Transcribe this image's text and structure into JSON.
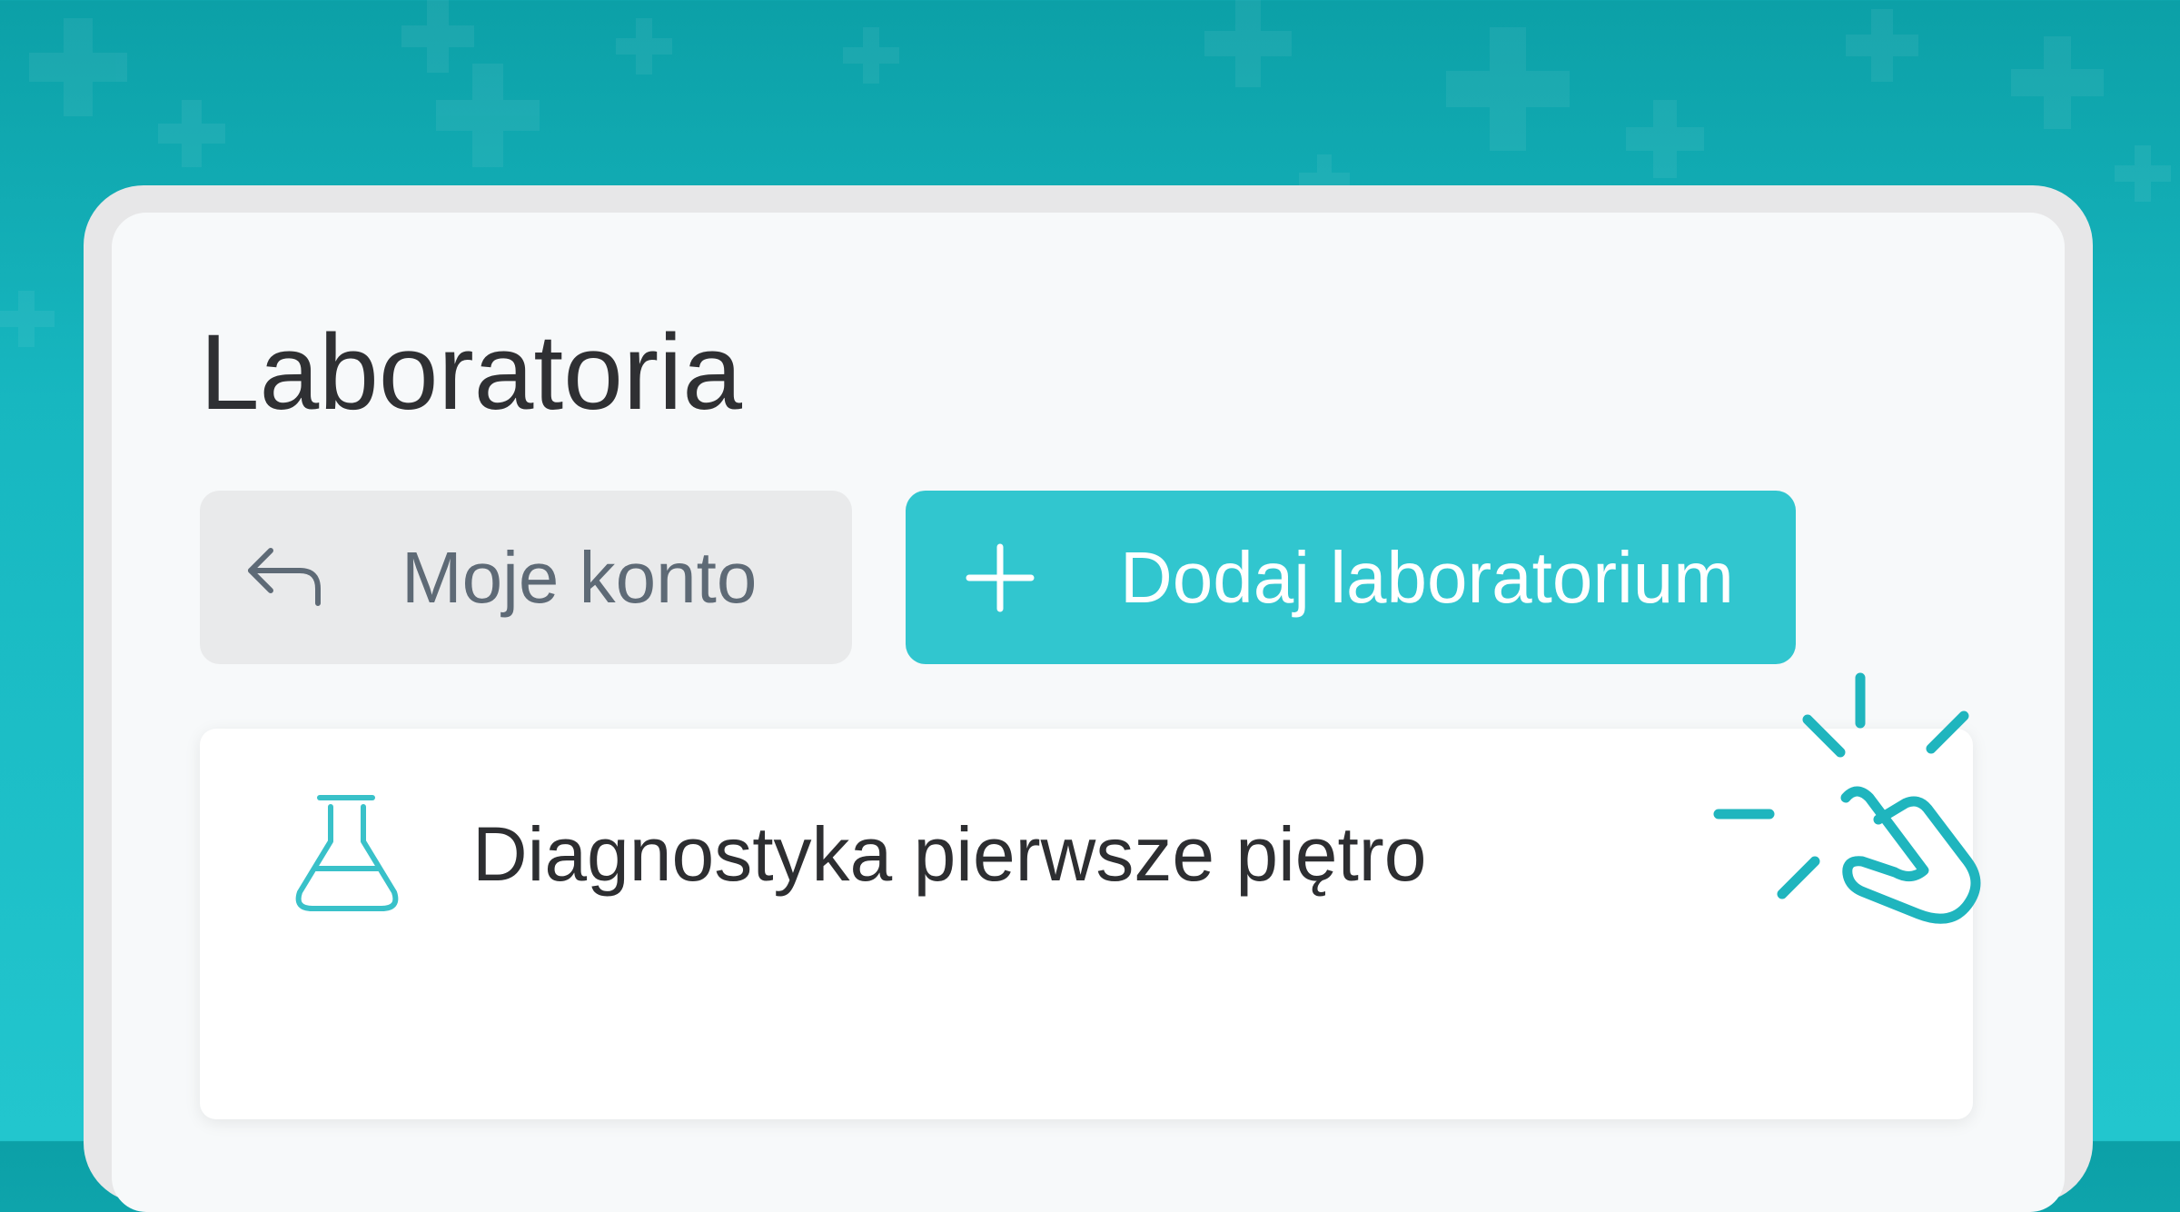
{
  "page": {
    "title": "Laboratoria"
  },
  "toolbar": {
    "back_button": {
      "label": "Moje konto",
      "icon": "reply-arrow-icon"
    },
    "add_button": {
      "label": "Dodaj laboratorium",
      "icon": "plus-icon"
    }
  },
  "labs": [
    {
      "name": "Diagnostyka pierwsze piętro",
      "icon": "flask-icon"
    }
  ],
  "colors": {
    "accent": "#31c6cf",
    "background_top": "#0ca0a7",
    "background_bottom": "#22c6ce",
    "icon_teal": "#1fb5be",
    "text_dark": "#2f3033",
    "secondary_text": "#5e6a76"
  }
}
